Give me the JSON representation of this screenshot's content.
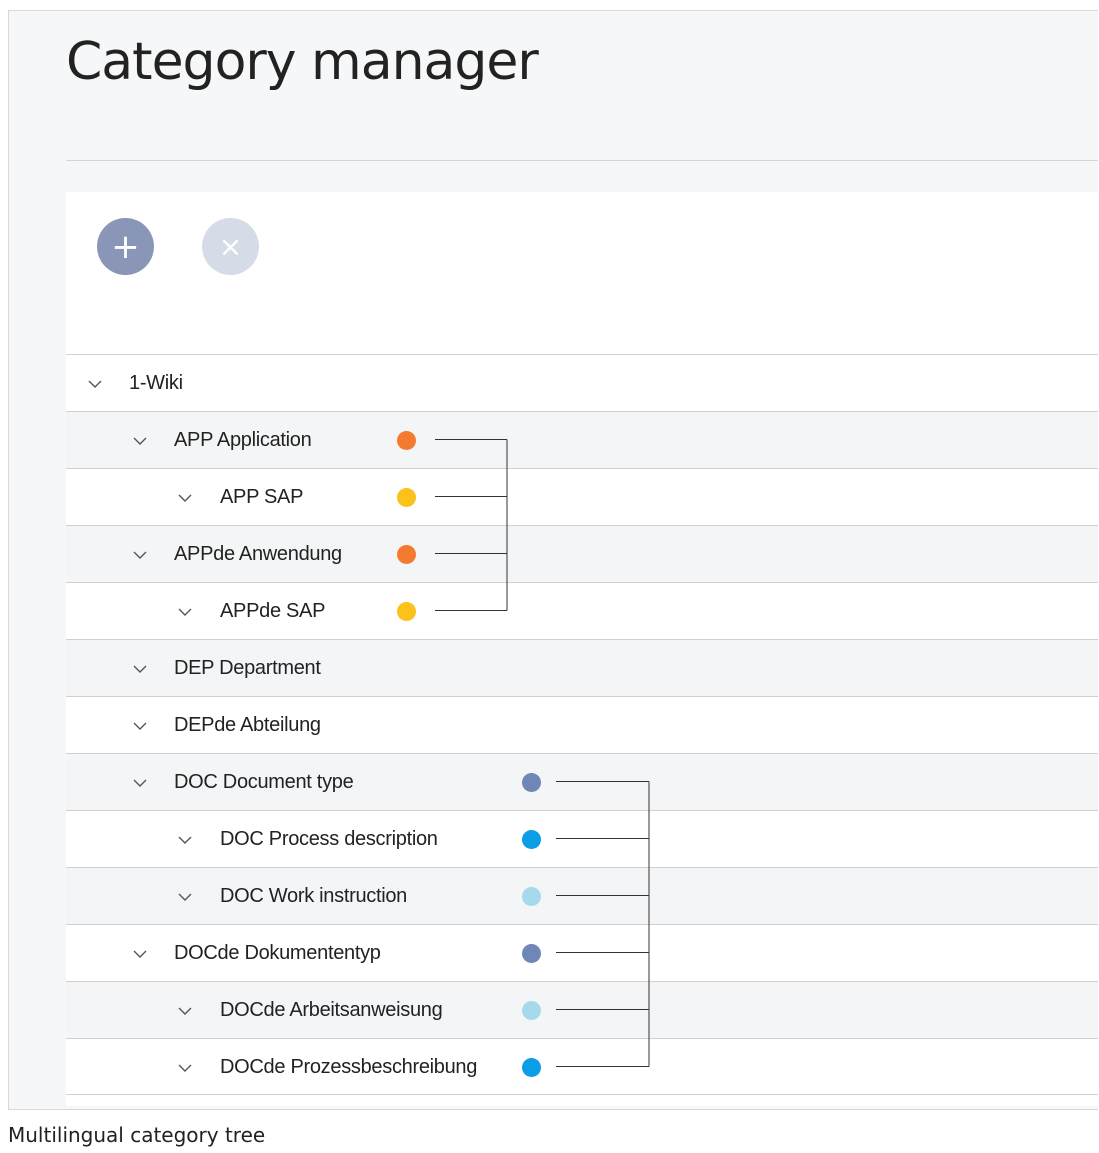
{
  "page": {
    "title": "Category manager",
    "caption": "Multilingual category tree"
  },
  "toolbar": {
    "add_icon": "+",
    "remove_icon": "×"
  },
  "colors": {
    "orange": "#f47a30",
    "yellow": "#fcc21a",
    "slate": "#6e87b7",
    "blue": "#0b9ee6",
    "lightblue": "#a6d9ea"
  },
  "tree": [
    {
      "label": "1-Wiki",
      "level": 0,
      "dot": null
    },
    {
      "label": "APP Application",
      "level": 1,
      "dot": "#f47a30"
    },
    {
      "label": "APP SAP",
      "level": 2,
      "dot": "#fcc21a"
    },
    {
      "label": "APPde Anwendung",
      "level": 1,
      "dot": "#f47a30"
    },
    {
      "label": "APPde SAP",
      "level": 2,
      "dot": "#fcc21a"
    },
    {
      "label": "DEP Department",
      "level": 1,
      "dot": null
    },
    {
      "label": "DEPde Abteilung",
      "level": 1,
      "dot": null
    },
    {
      "label": "DOC Document type",
      "level": 1,
      "dot": "#6e87b7"
    },
    {
      "label": "DOC Process description",
      "level": 2,
      "dot": "#0b9ee6"
    },
    {
      "label": "DOC Work instruction",
      "level": 2,
      "dot": "#a6d9ea"
    },
    {
      "label": "DOCde Dokumententyp",
      "level": 1,
      "dot": "#6e87b7"
    },
    {
      "label": "DOCde Arbeitsanweisung",
      "level": 2,
      "dot": "#a6d9ea"
    },
    {
      "label": "DOCde Prozessbeschreibung",
      "level": 2,
      "dot": "#0b9ee6"
    }
  ]
}
